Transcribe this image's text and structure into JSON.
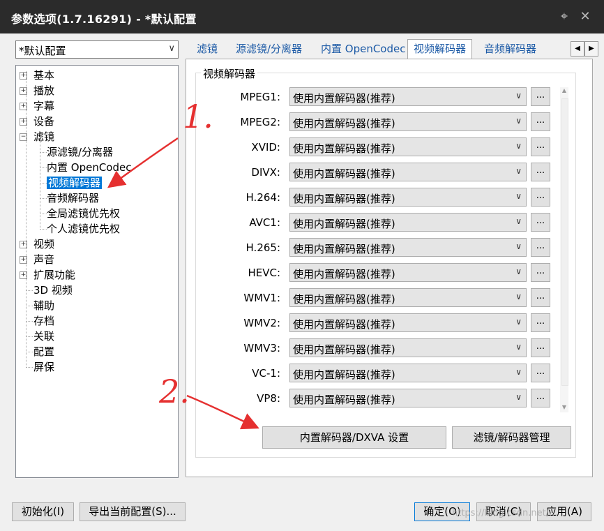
{
  "window": {
    "title": "参数选项(1.7.16291) - *默认配置"
  },
  "profile_combo": {
    "value": "*默认配置"
  },
  "tree": {
    "items": [
      "基本",
      "播放",
      "字幕",
      "设备",
      "滤镜"
    ],
    "filter_children": [
      "源滤镜/分离器",
      "内置 OpenCodec",
      "视频解码器",
      "音频解码器",
      "全局滤镜优先权",
      "个人滤镜优先权"
    ],
    "items_after": [
      "视频",
      "声音",
      "扩展功能"
    ],
    "leaf_items": [
      "3D 视频",
      "辅助",
      "存档",
      "关联",
      "配置",
      "屏保"
    ]
  },
  "tabs": [
    "滤镜",
    "源滤镜/分离器",
    "内置 OpenCodec",
    "视频解码器",
    "音频解码器",
    "?"
  ],
  "group_label": "视频解码器",
  "decoders": [
    {
      "label": "MPEG1:",
      "value": "使用内置解码器(推荐)"
    },
    {
      "label": "MPEG2:",
      "value": "使用内置解码器(推荐)"
    },
    {
      "label": "XVID:",
      "value": "使用内置解码器(推荐)"
    },
    {
      "label": "DIVX:",
      "value": "使用内置解码器(推荐)"
    },
    {
      "label": "H.264:",
      "value": "使用内置解码器(推荐)"
    },
    {
      "label": "AVC1:",
      "value": "使用内置解码器(推荐)"
    },
    {
      "label": "H.265:",
      "value": "使用内置解码器(推荐)"
    },
    {
      "label": "HEVC:",
      "value": "使用内置解码器(推荐)"
    },
    {
      "label": "WMV1:",
      "value": "使用内置解码器(推荐)"
    },
    {
      "label": "WMV2:",
      "value": "使用内置解码器(推荐)"
    },
    {
      "label": "WMV3:",
      "value": "使用内置解码器(推荐)"
    },
    {
      "label": "VC-1:",
      "value": "使用内置解码器(推荐)"
    },
    {
      "label": "VP8:",
      "value": "使用内置解码器(推荐)"
    }
  ],
  "dots_label": "...",
  "panel_buttons": {
    "dxva": "内置解码器/DXVA 设置",
    "manage": "滤镜/解码器管理"
  },
  "footer_buttons": {
    "init": "初始化(I)",
    "export": "导出当前配置(S)...",
    "ok": "确定(O)",
    "cancel": "取消(C)",
    "apply": "应用(A)"
  },
  "annotations": {
    "one": "1.",
    "two": "2."
  },
  "watermark": "https://blog.csdn.net/..."
}
